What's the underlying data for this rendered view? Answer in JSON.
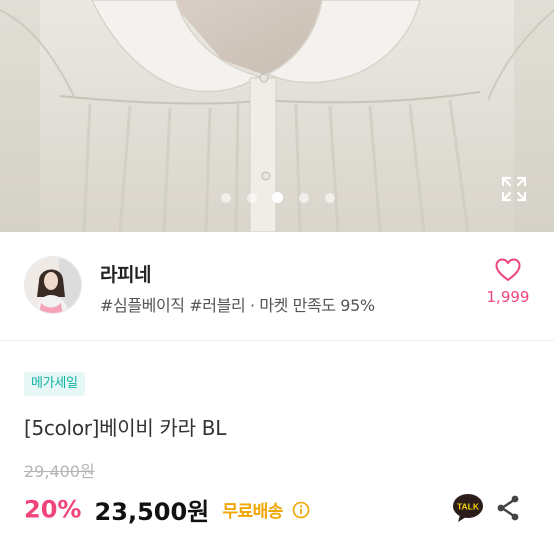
{
  "hero": {
    "carousel": {
      "count": 5,
      "active_index": 2
    },
    "expand_icon": "expand-icon"
  },
  "seller": {
    "name": "라피네",
    "tags": "#심플베이직 #러블리 · 마켓 만족도 95%",
    "like_count": "1,999",
    "like_icon": "heart-outline-icon",
    "accent_color": "#f0457a"
  },
  "product": {
    "badge": "메가세일",
    "title": "[5color]베이비 카라 BL",
    "original_price": "29,400원",
    "discount": "20%",
    "price": "23,500원",
    "shipping": "무료배송",
    "shipping_color": "#f0a500",
    "info_icon": "info-circle-icon",
    "talk_icon": "kakao-talk-icon",
    "share_icon": "share-icon"
  }
}
